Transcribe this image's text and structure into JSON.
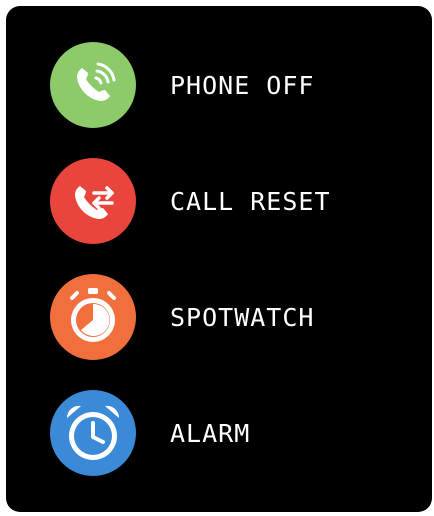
{
  "menu": {
    "items": [
      {
        "label": "PHONE OFF",
        "icon": "phone-ringing-icon",
        "color": "#8cca6a"
      },
      {
        "label": "CALL RESET",
        "icon": "call-transfer-icon",
        "color": "#e8453c"
      },
      {
        "label": "SPOTWATCH",
        "icon": "stopwatch-icon",
        "color": "#f06f3c"
      },
      {
        "label": "ALARM",
        "icon": "alarm-clock-icon",
        "color": "#3b8ad8"
      }
    ]
  }
}
